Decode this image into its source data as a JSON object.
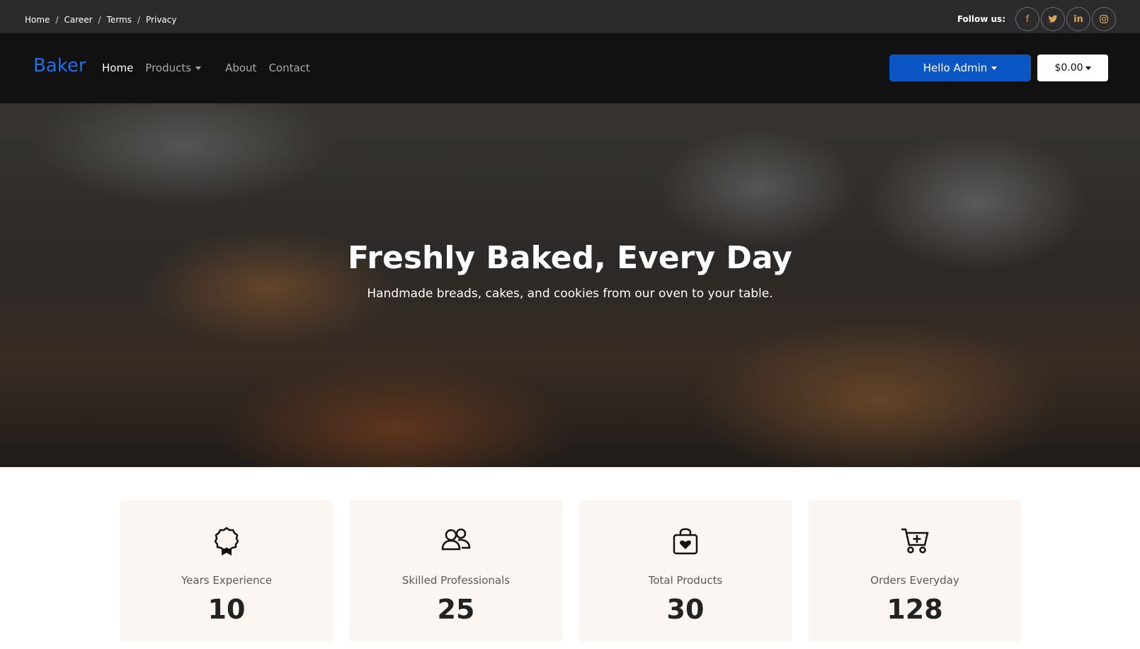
{
  "topbar": {
    "breadcrumbs": [
      "Home",
      "Career",
      "Terms",
      "Privacy"
    ],
    "follow_label": "Follow us:",
    "social": [
      {
        "icon": "facebook-icon",
        "glyph": "f"
      },
      {
        "icon": "twitter-icon",
        "glyph": "t"
      },
      {
        "icon": "linkedin-icon",
        "glyph": "in"
      },
      {
        "icon": "instagram-icon",
        "glyph": "◎"
      }
    ]
  },
  "navbar": {
    "brand": "Baker",
    "links": [
      "Home",
      "Products",
      "About",
      "Contact"
    ],
    "admin_label": "Hello Admin",
    "cart_total": "$0.00"
  },
  "hero": {
    "title": "Freshly Baked, Every Day",
    "subtitle": "Handmade breads, cakes, and cookies from our oven to your table."
  },
  "stats": [
    {
      "icon": "award-icon",
      "label": "Years Experience",
      "value": "10"
    },
    {
      "icon": "people-icon",
      "label": "Skilled Professionals",
      "value": "25"
    },
    {
      "icon": "shopping-bag-icon",
      "label": "Total Products",
      "value": "30"
    },
    {
      "icon": "cart-add-icon",
      "label": "Orders Everyday",
      "value": "128"
    }
  ],
  "colors": {
    "brand": "#1f6feb",
    "primary_button": "#0a56c4",
    "social_icon": "#d7a65c",
    "card_bg": "#fbf6f2"
  }
}
